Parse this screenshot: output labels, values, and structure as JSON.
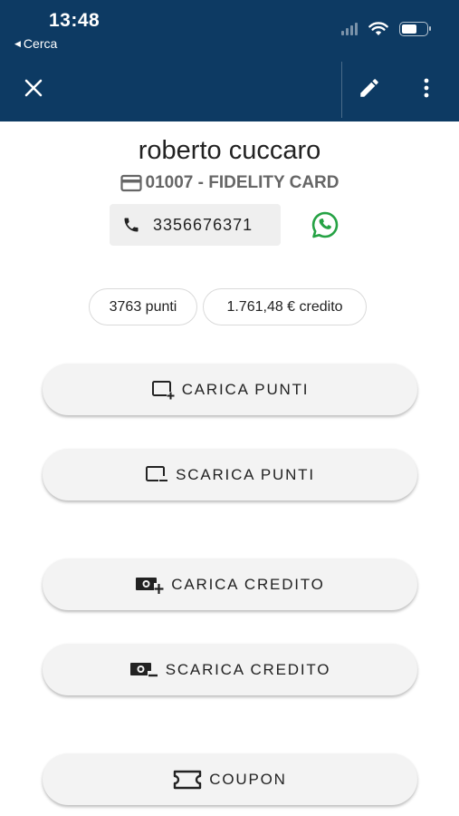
{
  "status_bar": {
    "time": "13:48",
    "back_label": "Cerca"
  },
  "customer": {
    "name": "roberto cuccaro",
    "card": "01007 - FIDELITY CARD",
    "phone": "3356676371"
  },
  "balances": {
    "points": "3763 punti",
    "credit": "1.761,48 € credito"
  },
  "actions": {
    "load_points": "CARICA PUNTI",
    "unload_points": "SCARICA PUNTI",
    "load_credit": "CARICA CREDITO",
    "unload_credit": "SCARICA CREDITO",
    "coupon": "COUPON"
  },
  "icons": {
    "close": "close-icon",
    "edit": "pencil-icon",
    "more": "more-vertical-icon",
    "card": "credit-card-icon",
    "phone": "phone-icon",
    "whatsapp": "whatsapp-icon"
  },
  "colors": {
    "header": "#0d3a63",
    "whatsapp": "#25a244",
    "chip": "#efefef"
  }
}
